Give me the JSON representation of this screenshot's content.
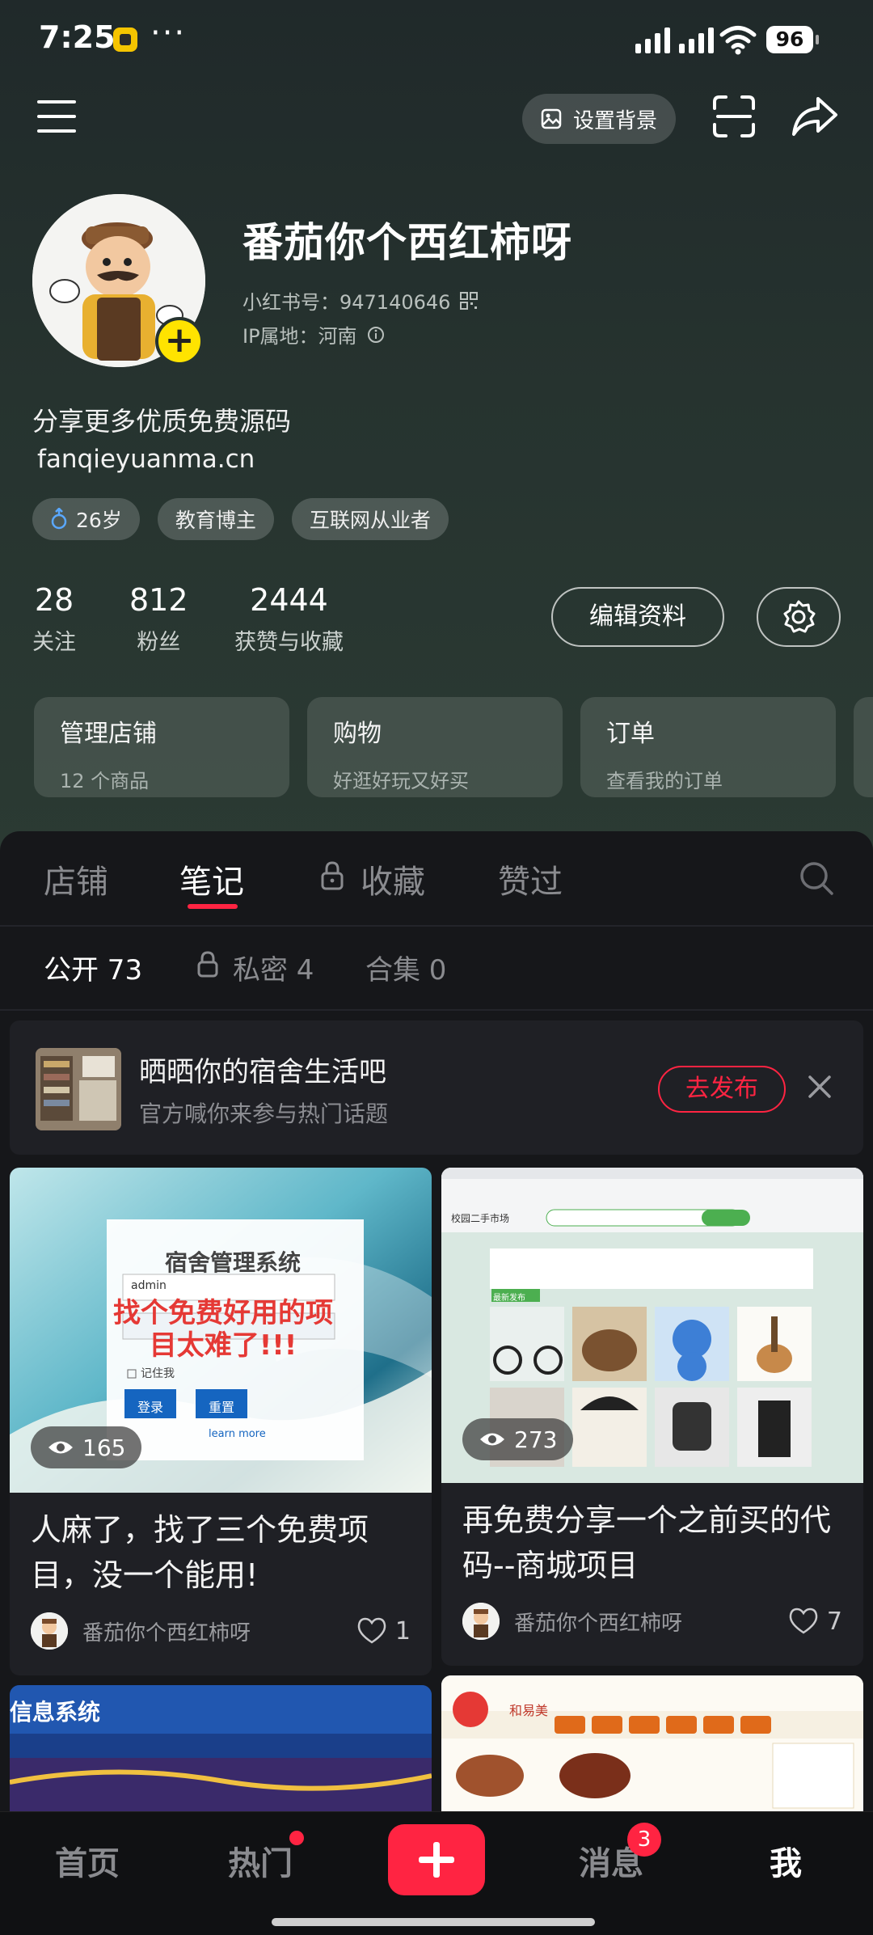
{
  "status_bar": {
    "time": "7:25",
    "more": "···",
    "battery": "96"
  },
  "top_bar": {
    "set_background_label": "设置背景"
  },
  "profile": {
    "nickname": "番茄你个西红柿呀",
    "id_line": "小红书号：947140646",
    "ip_line": "IP属地：河南",
    "bio": "分享更多优质免费源码",
    "bio_link": "fanqieyuanma.cn",
    "tags": [
      "26岁",
      "教育博主",
      "互联网从业者"
    ]
  },
  "stats": [
    {
      "num": "28",
      "label": "关注"
    },
    {
      "num": "812",
      "label": "粉丝"
    },
    {
      "num": "2444",
      "label": "获赞与收藏"
    }
  ],
  "edit_profile_label": "编辑资料",
  "cards": [
    {
      "title": "管理店铺",
      "sub": "12 个商品"
    },
    {
      "title": "购物",
      "sub": "好逛好玩又好买"
    },
    {
      "title": "订单",
      "sub": "查看我的订单"
    }
  ],
  "tabs": [
    "店铺",
    "笔记",
    "收藏",
    "赞过"
  ],
  "subtabs": [
    "公开 73",
    "私密 4",
    "合集 0"
  ],
  "banner": {
    "title": "晒晒你的宿舍生活吧",
    "subtitle": "官方喊你来参与热门话题",
    "button": "去发布"
  },
  "notes": [
    {
      "views": "165",
      "title": "人麻了，找了三个免费项目，没一个能用!",
      "author": "番茄你个西红柿呀",
      "likes": "1",
      "img_texts": {
        "system_title": "宿舍管理系统",
        "username": "admin",
        "overlay": "找个免费好用的项目太难了!!!",
        "remember": "记住我",
        "login": "登录",
        "reset": "重置",
        "learn_more": "learn more"
      }
    },
    {
      "views": "273",
      "title": "再免费分享一个之前买的代码--商城项目",
      "author": "番茄你个西红柿呀",
      "likes": "7",
      "img_texts": {
        "site_title": "校园二手市场",
        "section": "最新发布"
      }
    },
    {
      "img_texts": {
        "title": "信息系统"
      }
    },
    {
      "img_texts": {
        "brand": "和易美"
      }
    }
  ],
  "bottom_nav": {
    "home": "首页",
    "hot": "热门",
    "messages": "消息",
    "messages_badge": "3",
    "me": "我"
  },
  "colors": {
    "accent": "#ff2442",
    "header_bg": "#26332f",
    "panel_bg": "#16171a"
  }
}
